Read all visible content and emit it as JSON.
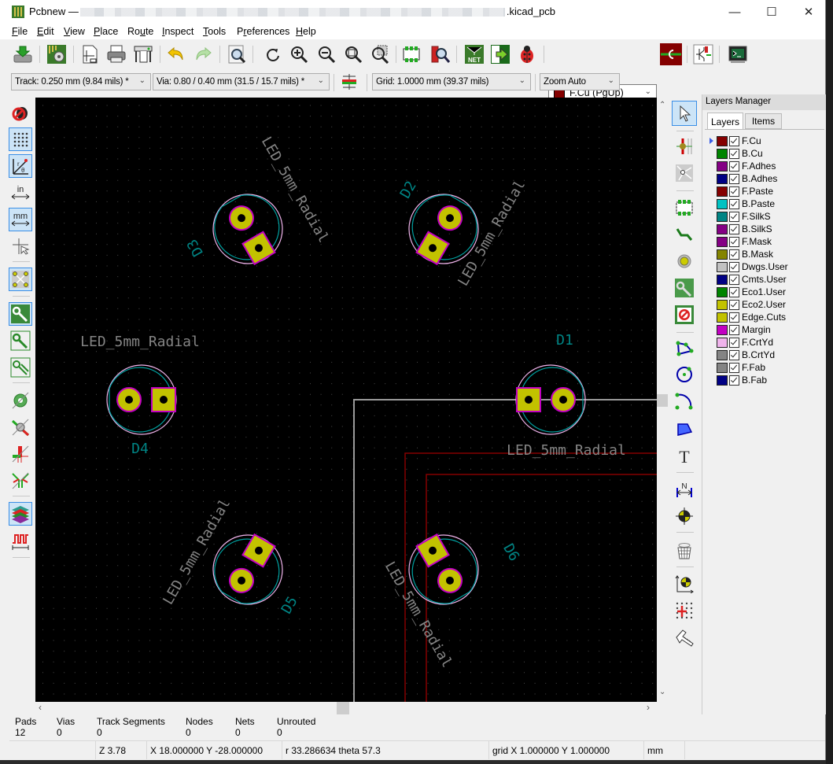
{
  "window": {
    "app_name": "Pcbnew —",
    "file_suffix": ".kicad_pcb",
    "minimize_label": "—",
    "maximize_label": "☐",
    "close_label": "✕"
  },
  "menu": [
    {
      "label": "File",
      "accel": "F"
    },
    {
      "label": "Edit",
      "accel": "E"
    },
    {
      "label": "View",
      "accel": "V"
    },
    {
      "label": "Place",
      "accel": "P"
    },
    {
      "label": "Route",
      "accel": "u"
    },
    {
      "label": "Inspect",
      "accel": "I"
    },
    {
      "label": "Tools",
      "accel": "T"
    },
    {
      "label": "Preferences",
      "accel": "r"
    },
    {
      "label": "Help",
      "accel": "H"
    }
  ],
  "toolbar": {
    "icons": [
      "save-icon",
      "board-setup-icon",
      "page-settings-icon",
      "print-icon",
      "plot-icon",
      "undo-icon",
      "redo-icon",
      "find-icon",
      "redraw-icon",
      "zoom-in-icon",
      "zoom-out-icon",
      "zoom-fit-icon",
      "zoom-selection-icon",
      "footprint-editor-icon",
      "footprint-viewer-icon",
      "netlist-icon",
      "update-from-schematic-icon",
      "drc-icon",
      "layer-pair-icon",
      "scripting-console-icon"
    ],
    "active_layer": "F.Cu (PgUp)",
    "active_layer_color": "#840000",
    "netlist_label": "NET"
  },
  "aux_toolbar": {
    "track": "Track: 0.250 mm (9.84 mils) *",
    "via": "Via: 0.80 / 0.40 mm (31.5 / 15.7 mils) *",
    "grid": "Grid: 1.0000 mm (39.37 mils)",
    "zoom": "Zoom Auto"
  },
  "left_toolbar": [
    {
      "name": "drc-off-icon",
      "active": false
    },
    {
      "name": "grid-toggle-icon",
      "active": true
    },
    {
      "name": "polar-coords-icon",
      "active": true
    },
    {
      "name": "inch-units-icon",
      "active": false,
      "text": "in"
    },
    {
      "name": "mm-units-icon",
      "active": true,
      "text": "mm"
    },
    {
      "name": "cursor-shape-icon",
      "active": false
    },
    {
      "name": "ratsnest-icon",
      "active": true
    },
    {
      "name": "zone-fill-icon",
      "active": true
    },
    {
      "name": "zone-outline-icon",
      "active": false
    },
    {
      "name": "zone-fill-sketch-icon",
      "active": false
    },
    {
      "name": "pad-sketch-icon",
      "active": false
    },
    {
      "name": "via-sketch-icon",
      "active": false
    },
    {
      "name": "track-sketch-icon",
      "active": false
    },
    {
      "name": "hide-tracks-icon",
      "active": false
    },
    {
      "name": "high-contrast-icon",
      "active": true
    },
    {
      "name": "microwave-tools-icon",
      "active": false
    }
  ],
  "right_toolbar": [
    "select-icon",
    "highlight-net-icon",
    "local-ratsnest-icon",
    "add-footprint-icon",
    "route-track-icon",
    "add-via-icon",
    "add-zone-icon",
    "add-keepout-icon",
    "add-line-icon",
    "add-circle-icon",
    "add-arc-icon",
    "add-polygon-icon",
    "add-text-icon",
    "add-dimension-icon",
    "add-target-icon",
    "delete-icon",
    "set-origin-icon",
    "grid-origin-icon",
    "measure-icon"
  ],
  "layers_manager": {
    "title": "Layers Manager",
    "tabs": [
      "Layers",
      "Items"
    ],
    "active_tab": "Layers",
    "layers": [
      {
        "name": "F.Cu",
        "color": "#840000",
        "visible": true,
        "selected": true
      },
      {
        "name": "B.Cu",
        "color": "#008400",
        "visible": true
      },
      {
        "name": "F.Adhes",
        "color": "#840084",
        "visible": true
      },
      {
        "name": "B.Adhes",
        "color": "#000084",
        "visible": true
      },
      {
        "name": "F.Paste",
        "color": "#840000",
        "visible": true
      },
      {
        "name": "B.Paste",
        "color": "#00c2c2",
        "visible": true
      },
      {
        "name": "F.SilkS",
        "color": "#008484",
        "visible": true
      },
      {
        "name": "B.SilkS",
        "color": "#840084",
        "visible": true
      },
      {
        "name": "F.Mask",
        "color": "#840084",
        "visible": true
      },
      {
        "name": "B.Mask",
        "color": "#848400",
        "visible": true
      },
      {
        "name": "Dwgs.User",
        "color": "#c2c2c2",
        "visible": true
      },
      {
        "name": "Cmts.User",
        "color": "#000084",
        "visible": true
      },
      {
        "name": "Eco1.User",
        "color": "#008400",
        "visible": true
      },
      {
        "name": "Eco2.User",
        "color": "#c2c200",
        "visible": true
      },
      {
        "name": "Edge.Cuts",
        "color": "#c2c200",
        "visible": true
      },
      {
        "name": "Margin",
        "color": "#c200c2",
        "visible": true
      },
      {
        "name": "F.CrtYd",
        "color": "#f0b4ec",
        "visible": true
      },
      {
        "name": "B.CrtYd",
        "color": "#848484",
        "visible": true
      },
      {
        "name": "F.Fab",
        "color": "#848484",
        "visible": true
      },
      {
        "name": "B.Fab",
        "color": "#000084",
        "visible": true
      }
    ]
  },
  "board": {
    "footprints": [
      {
        "ref": "D1",
        "value": "LED_5mm_Radial",
        "rotation": 0
      },
      {
        "ref": "D2",
        "value": "LED_5mm_Radial",
        "rotation": 60
      },
      {
        "ref": "D3",
        "value": "LED_5mm_Radial",
        "rotation": 120
      },
      {
        "ref": "D4",
        "value": "LED_5mm_Radial",
        "rotation": 180
      },
      {
        "ref": "D5",
        "value": "LED_5mm_Radial",
        "rotation": 240
      },
      {
        "ref": "D6",
        "value": "LED_5mm_Radial",
        "rotation": 300
      }
    ],
    "colors": {
      "background": "#000000",
      "grid": "#4a4a4a",
      "pad": "#c2c200",
      "pad_outline": "#c200c2",
      "silk_ref": "#008484",
      "silk_val": "#848484",
      "courtyard": "#f0b4ec",
      "fab": "#00a0a0",
      "edge": "#9a9a9a",
      "zone": "#840000"
    }
  },
  "msg_panel": [
    {
      "label": "Pads",
      "value": "12"
    },
    {
      "label": "Vias",
      "value": "0"
    },
    {
      "label": "Track Segments",
      "value": "0"
    },
    {
      "label": "Nodes",
      "value": "0"
    },
    {
      "label": "Nets",
      "value": "0"
    },
    {
      "label": "Unrouted",
      "value": "0"
    }
  ],
  "status_bar": {
    "zoom": "Z 3.78",
    "cursor": "X 18.000000  Y -28.000000",
    "polar": "r 33.286634  theta 57.3",
    "grid": "grid X 1.000000  Y 1.000000",
    "units": "mm"
  }
}
